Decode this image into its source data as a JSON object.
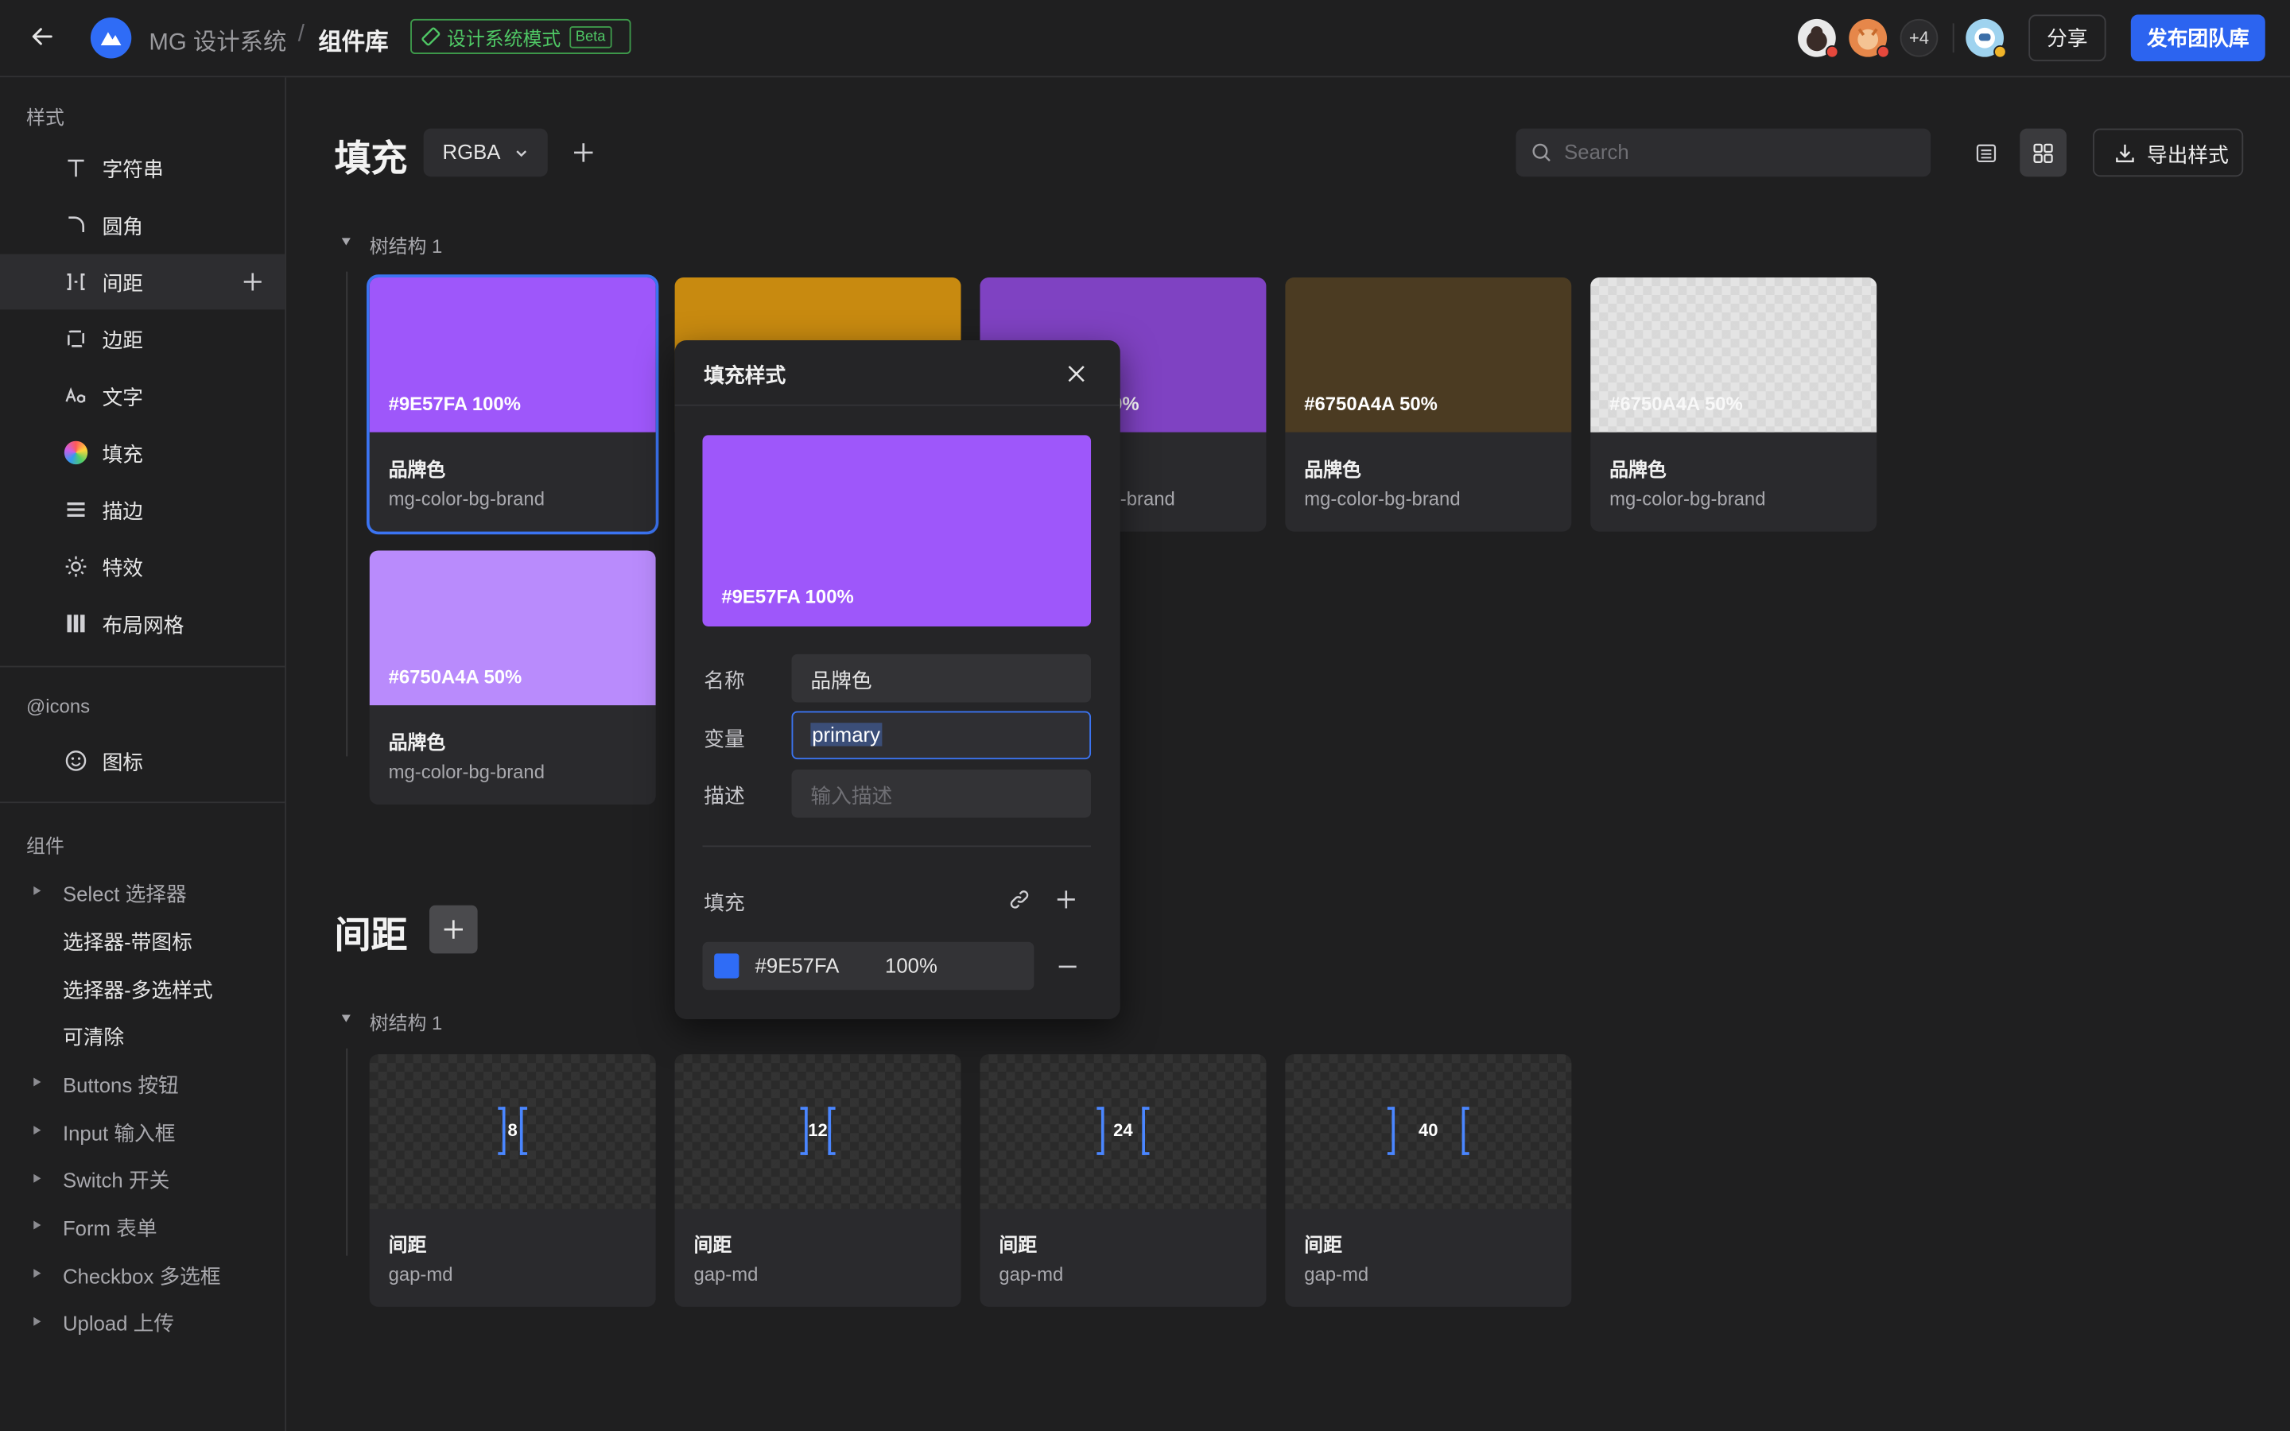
{
  "header": {
    "brand": "MG 设计系统",
    "separator": "/",
    "crumb": "组件库",
    "mode_label": "设计系统模式",
    "beta": "Beta",
    "extra_users": "+4",
    "share_label": "分享",
    "publish_label": "发布团队库",
    "colors": {
      "accent": "#2c64f0",
      "mode_green": "#4fc865"
    }
  },
  "sidebar": {
    "styles_title": "样式",
    "styles": [
      {
        "label": "字符串",
        "icon": "text-t-icon"
      },
      {
        "label": "圆角",
        "icon": "corner-radius-icon"
      },
      {
        "label": "间距",
        "icon": "spacing-icon",
        "active": true
      },
      {
        "label": "边距",
        "icon": "padding-icon"
      },
      {
        "label": "文字",
        "icon": "typography-icon"
      },
      {
        "label": "填充",
        "icon": "color-fill-icon"
      },
      {
        "label": "描边",
        "icon": "stroke-icon"
      },
      {
        "label": "特效",
        "icon": "effect-sun-icon"
      },
      {
        "label": "布局网格",
        "icon": "layout-grid-icon"
      }
    ],
    "icons_title": "@icons",
    "icons_item": "图标",
    "components_title": "组件",
    "components": [
      {
        "label": "Select 选择器",
        "expandable": true
      },
      {
        "label": "选择器-带图标",
        "child": true
      },
      {
        "label": "选择器-多选样式",
        "child": true
      },
      {
        "label": "可清除",
        "child": true
      },
      {
        "label": "Buttons 按钮",
        "expandable": true
      },
      {
        "label": "Input 输入框",
        "expandable": true
      },
      {
        "label": "Switch 开关",
        "expandable": true
      },
      {
        "label": "Form 表单",
        "expandable": true
      },
      {
        "label": "Checkbox 多选框",
        "expandable": true
      },
      {
        "label": "Upload 上传",
        "expandable": true
      }
    ]
  },
  "fill_section": {
    "title": "填充",
    "format": "RGBA",
    "search_placeholder": "Search",
    "export_label": "导出样式",
    "tree_label": "树结构 1",
    "cards": [
      {
        "hex": "#9E57FA  100%",
        "name": "品牌色",
        "token": "mg-color-bg-brand",
        "color": "#9e57fa",
        "selected": true
      },
      {
        "hex": "",
        "name": "",
        "token": "",
        "color": "#c88a10"
      },
      {
        "hex": "0%",
        "name": "",
        "token": "-brand",
        "color": "#7f42c2"
      },
      {
        "hex": "#6750A4A  50%",
        "name": "品牌色",
        "token": "mg-color-bg-brand",
        "color": "#4b3b22"
      },
      {
        "hex": "#6750A4A  50%",
        "name": "品牌色",
        "token": "mg-color-bg-brand",
        "color": "#e4e4e4"
      },
      {
        "hex": "#6750A4A  50%",
        "name": "品牌色",
        "token": "mg-color-bg-brand",
        "color": "#b98bfc"
      }
    ]
  },
  "gap_section": {
    "title": "间距",
    "tree_label": "树结构 1",
    "cards": [
      {
        "value": "8",
        "name": "间距",
        "token": "gap-md"
      },
      {
        "value": "12",
        "name": "间距",
        "token": "gap-md"
      },
      {
        "value": "24",
        "name": "间距",
        "token": "gap-md"
      },
      {
        "value": "40",
        "name": "间距",
        "token": "gap-md"
      }
    ]
  },
  "popover": {
    "title": "填充样式",
    "preview_hex": "#9E57FA  100%",
    "preview_color": "#9e57fa",
    "name_label": "名称",
    "name_value": "品牌色",
    "variable_label": "变量",
    "variable_value": "primary",
    "desc_label": "描述",
    "desc_placeholder": "输入描述",
    "fill_label": "填充",
    "fill_hex": "#9E57FA",
    "fill_opacity": "100%",
    "fill_chip_color": "#2f6cf6"
  }
}
